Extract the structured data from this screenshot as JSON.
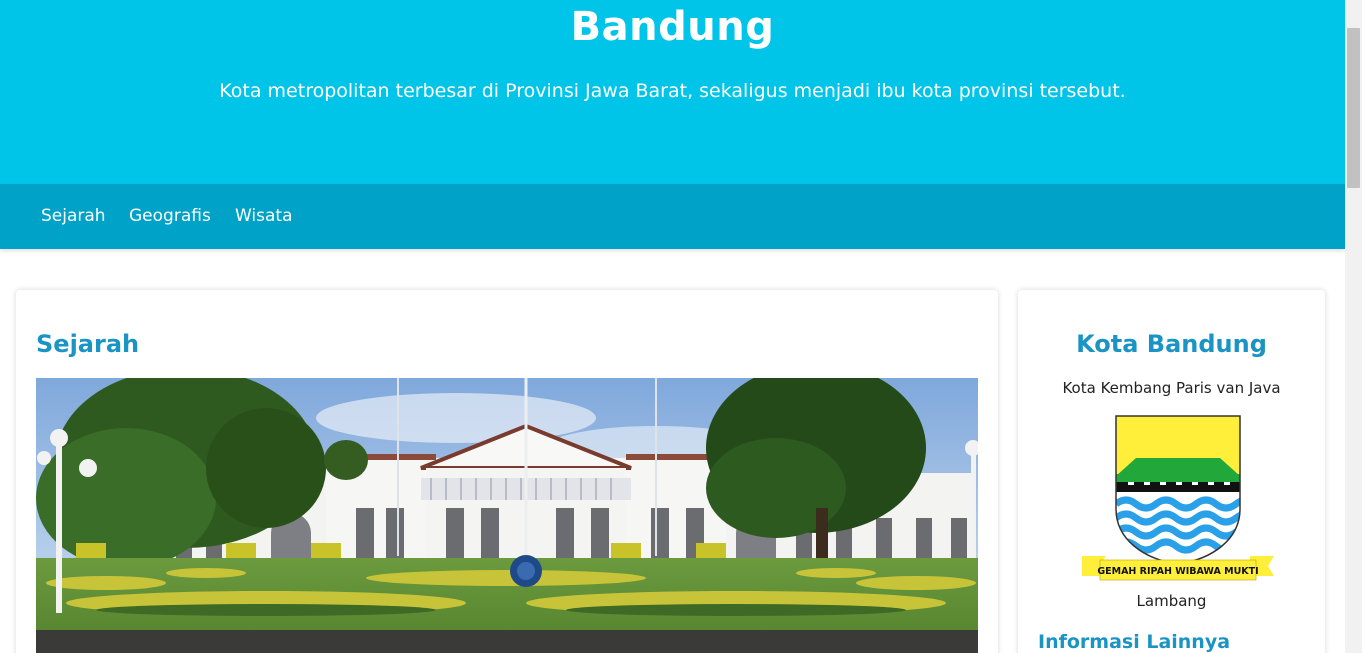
{
  "header": {
    "title": "Bandung",
    "subtitle": "Kota metropolitan terbesar di Provinsi Jawa Barat, sekaligus menjadi ibu kota provinsi tersebut."
  },
  "nav": {
    "items": [
      {
        "label": "Sejarah"
      },
      {
        "label": "Geografis"
      },
      {
        "label": "Wisata"
      }
    ]
  },
  "main": {
    "section_title": "Sejarah"
  },
  "sidebar": {
    "title": "Kota Bandung",
    "subtitle": "Kota Kembang Paris van Java",
    "emblem_motto": "GEMAH RIPAH WIBAWA MUKTI",
    "emblem_caption": "Lambang",
    "more_heading": "Informasi Lainnya"
  },
  "colors": {
    "hero": "#00c5e8",
    "nav": "#00a2c7",
    "heading": "#1a94c4"
  }
}
